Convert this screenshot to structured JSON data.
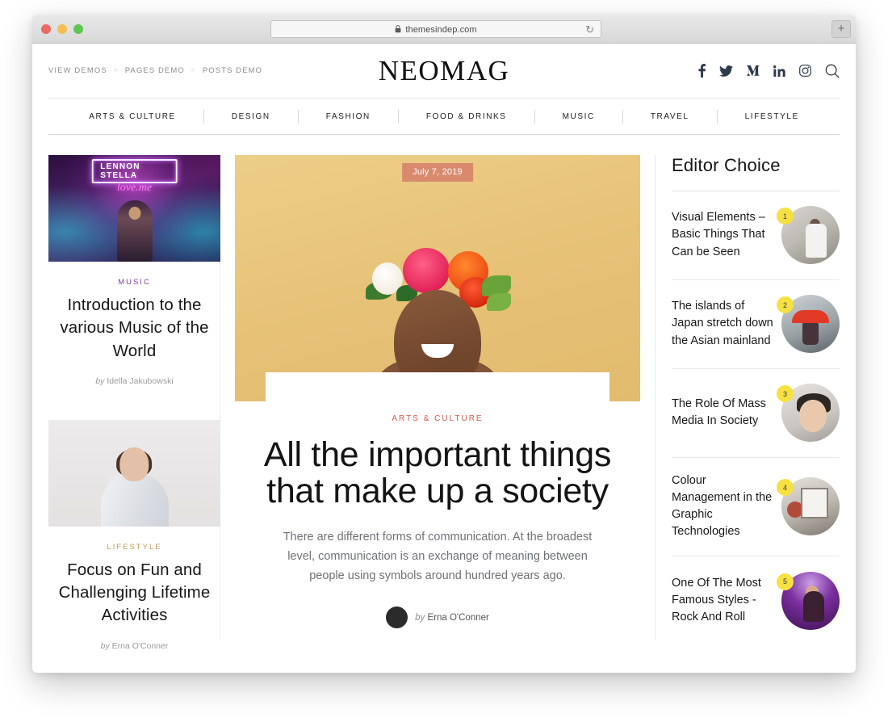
{
  "browser": {
    "url": "themesindep.com",
    "lock_icon": "lock-icon",
    "reload_icon": "reload-icon",
    "newtab_label": "+"
  },
  "header": {
    "logo": "NEOMAG",
    "demo_links": [
      {
        "label": "VIEW DEMOS"
      },
      {
        "label": "PAGES DEMO"
      },
      {
        "label": "POSTS DEMO"
      }
    ],
    "separator": "○",
    "social": [
      {
        "name": "facebook-icon"
      },
      {
        "name": "twitter-icon"
      },
      {
        "name": "medium-icon"
      },
      {
        "name": "linkedin-icon"
      },
      {
        "name": "instagram-icon"
      }
    ],
    "search_icon": "search-icon"
  },
  "nav": {
    "items": [
      {
        "label": "ARTS & CULTURE"
      },
      {
        "label": "DESIGN"
      },
      {
        "label": "FASHION"
      },
      {
        "label": "FOOD & DRINKS"
      },
      {
        "label": "MUSIC"
      },
      {
        "label": "TRAVEL"
      },
      {
        "label": "LIFESTYLE"
      }
    ]
  },
  "left_column": {
    "cards": [
      {
        "category": "MUSIC",
        "category_color": "#7b3fa0",
        "title": "Introduction to the various Music of the World",
        "byline_prefix": "by",
        "author": "Idella Jakubowski",
        "image": "concert-neon-lennon-stella"
      },
      {
        "category": "LIFESTYLE",
        "category_color": "#c49a5a",
        "title": "Focus on Fun and Challenging Lifetime Activities",
        "byline_prefix": "by",
        "author": "Erna O'Conner",
        "image": "woman-gray-background"
      }
    ]
  },
  "feature": {
    "date": "July 7, 2019",
    "category": "ARTS & CULTURE",
    "category_color": "#cd5c4f",
    "title": "All the important things that make up a society",
    "excerpt": "There are different forms of communication. At the broadest level, communication is an exchange of meaning between people using symbols around hundred years ago.",
    "byline_prefix": "by",
    "author": "Erna O'Conner",
    "image": "woman-floral-crown-yellow",
    "avatar": "author-avatar"
  },
  "sidebar": {
    "title": "Editor Choice",
    "badge_color": "#f6e043",
    "items": [
      {
        "number": "1",
        "title": "Visual Elements – Basic Things That Can be Seen",
        "image": "woman-white-shirt-thumb"
      },
      {
        "number": "2",
        "title": "The islands of Japan stretch down the Asian mainland",
        "image": "red-umbrella-japan-thumb"
      },
      {
        "number": "3",
        "title": "The Role Of Mass Media In Society",
        "image": "woman-sunglasses-thumb"
      },
      {
        "number": "4",
        "title": "Colour Management in the Graphic Technologies",
        "image": "interior-window-thumb"
      },
      {
        "number": "5",
        "title": "One Of The Most Famous Styles - Rock And Roll",
        "image": "guitarist-purple-thumb"
      }
    ]
  }
}
